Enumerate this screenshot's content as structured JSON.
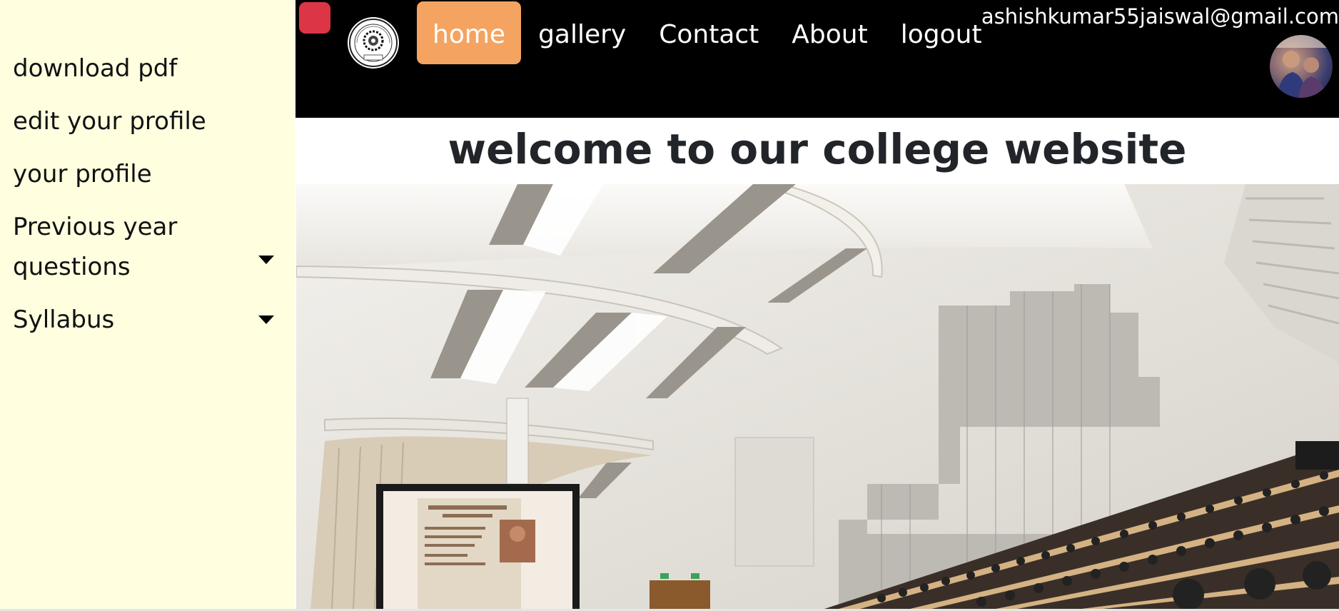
{
  "sidebar": {
    "items": [
      {
        "label": "download pdf"
      },
      {
        "label": "edit your profile"
      },
      {
        "label": "your profile"
      },
      {
        "label": "Previous year questions",
        "label_line1": "Previous year",
        "label_line2": "questions",
        "has_dropdown": true
      },
      {
        "label": "Syllabus",
        "has_dropdown": true
      }
    ]
  },
  "header": {
    "nav": [
      {
        "label": "home",
        "active": true
      },
      {
        "label": "gallery"
      },
      {
        "label": "Contact"
      },
      {
        "label": "About"
      },
      {
        "label": "logout"
      }
    ],
    "user_email": "ashishkumar55jaiswal@gmail.com",
    "close_button_color": "#dc3545",
    "active_nav_color": "#f4a460"
  },
  "main": {
    "welcome_text": "welcome to our college website"
  },
  "colors": {
    "sidebar_bg": "#ffffe0",
    "header_bg": "#000000"
  },
  "icons": {
    "dropdown": "caret-down-icon",
    "logo": "college-logo-icon"
  }
}
